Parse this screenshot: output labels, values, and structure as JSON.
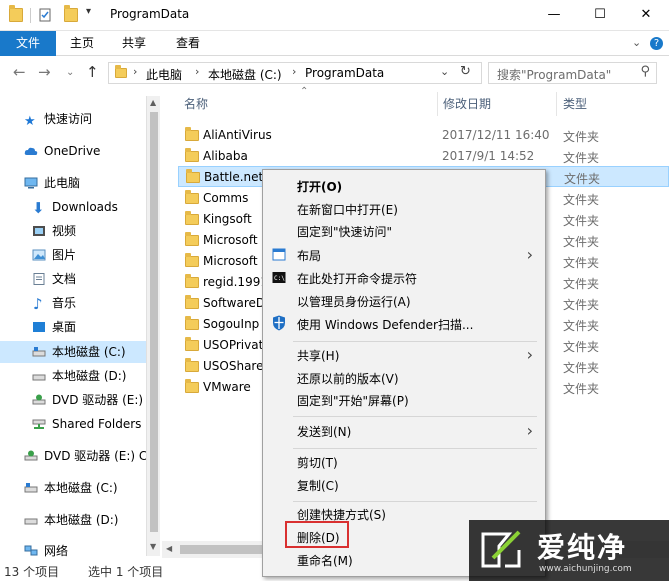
{
  "window": {
    "title": "ProgramData",
    "minimize": "—",
    "maximize": "☐",
    "close": "✕"
  },
  "ribbon": {
    "tabs": [
      "文件",
      "主页",
      "共享",
      "查看"
    ]
  },
  "address": {
    "segments": [
      "此电脑",
      "本地磁盘 (C:)",
      "ProgramData"
    ],
    "search_placeholder": "搜索\"ProgramData\""
  },
  "nav_pane": {
    "items": [
      {
        "label": "快速访问",
        "icon": "star-icon"
      },
      {
        "label": "OneDrive",
        "icon": "cloud-icon"
      },
      {
        "label": "此电脑",
        "icon": "computer-icon"
      },
      {
        "label": "Downloads",
        "icon": "download-icon"
      },
      {
        "label": "视频",
        "icon": "video-icon"
      },
      {
        "label": "图片",
        "icon": "picture-icon"
      },
      {
        "label": "文档",
        "icon": "document-icon"
      },
      {
        "label": "音乐",
        "icon": "music-icon"
      },
      {
        "label": "桌面",
        "icon": "desktop-icon"
      },
      {
        "label": "本地磁盘 (C:)",
        "icon": "drive-icon",
        "selected": true
      },
      {
        "label": "本地磁盘 (D:)",
        "icon": "drive-icon"
      },
      {
        "label": "DVD 驱动器 (E:)",
        "icon": "dvd-icon"
      },
      {
        "label": "Shared Folders",
        "icon": "network-drive-icon"
      },
      {
        "label": "DVD 驱动器 (E:) C",
        "icon": "dvd-icon"
      },
      {
        "label": "本地磁盘 (C:)",
        "icon": "drive-icon"
      },
      {
        "label": "本地磁盘 (D:)",
        "icon": "drive-icon"
      },
      {
        "label": "网络",
        "icon": "network-icon"
      }
    ]
  },
  "columns": {
    "name": "名称",
    "date": "修改日期",
    "type": "类型"
  },
  "files": [
    {
      "name": "AliAntiVirus",
      "date": "2017/12/11 16:40",
      "type": "文件夹"
    },
    {
      "name": "Alibaba",
      "date": "2017/9/1 14:52",
      "type": "文件夹"
    },
    {
      "name": "Battle.net",
      "date": "",
      "type": "文件夹",
      "selected": true
    },
    {
      "name": "Comms",
      "date": "",
      "type": "文件夹"
    },
    {
      "name": "Kingsoft",
      "date": "",
      "type": "文件夹"
    },
    {
      "name": "Microsoft",
      "date": "",
      "type": "文件夹"
    },
    {
      "name": "Microsoft",
      "date": "",
      "type": "文件夹"
    },
    {
      "name": "regid.1991",
      "date": "",
      "type": "文件夹"
    },
    {
      "name": "SoftwareD",
      "date": "",
      "type": "文件夹"
    },
    {
      "name": "SogouInp",
      "date": "",
      "type": "文件夹"
    },
    {
      "name": "USOPrivat",
      "date": "",
      "type": "文件夹"
    },
    {
      "name": "USOShare",
      "date": "",
      "type": "文件夹"
    },
    {
      "name": "VMware",
      "date": "",
      "type": "文件夹"
    }
  ],
  "status": {
    "count": "13 个项目",
    "selected": "选中 1 个项目"
  },
  "context_menu": {
    "items": [
      {
        "label": "打开(O)",
        "bold": true
      },
      {
        "label": "在新窗口中打开(E)"
      },
      {
        "label": "固定到\"快速访问\""
      },
      {
        "label": "布局",
        "icon": "layout-icon",
        "submenu": true
      },
      {
        "label": "在此处打开命令提示符",
        "icon": "cmd-icon"
      },
      {
        "label": "以管理员身份运行(A)"
      },
      {
        "label": "使用 Windows Defender扫描...",
        "icon": "defender-shield-icon"
      },
      {
        "label": "共享(H)",
        "submenu": true
      },
      {
        "label": "还原以前的版本(V)"
      },
      {
        "label": "固定到\"开始\"屏幕(P)"
      },
      {
        "label": "发送到(N)",
        "submenu": true
      },
      {
        "label": "剪切(T)"
      },
      {
        "label": "复制(C)"
      },
      {
        "label": "创建快捷方式(S)"
      },
      {
        "label": "删除(D)",
        "highlighted": true
      },
      {
        "label": "重命名(M)"
      }
    ]
  },
  "watermark": {
    "brand": "爱纯净",
    "url": "www.aichunjing.com"
  },
  "colors": {
    "accent": "#1979ca",
    "selection": "#cce8ff",
    "highlight_box": "#d93030",
    "folder": "#f4cc5a"
  }
}
